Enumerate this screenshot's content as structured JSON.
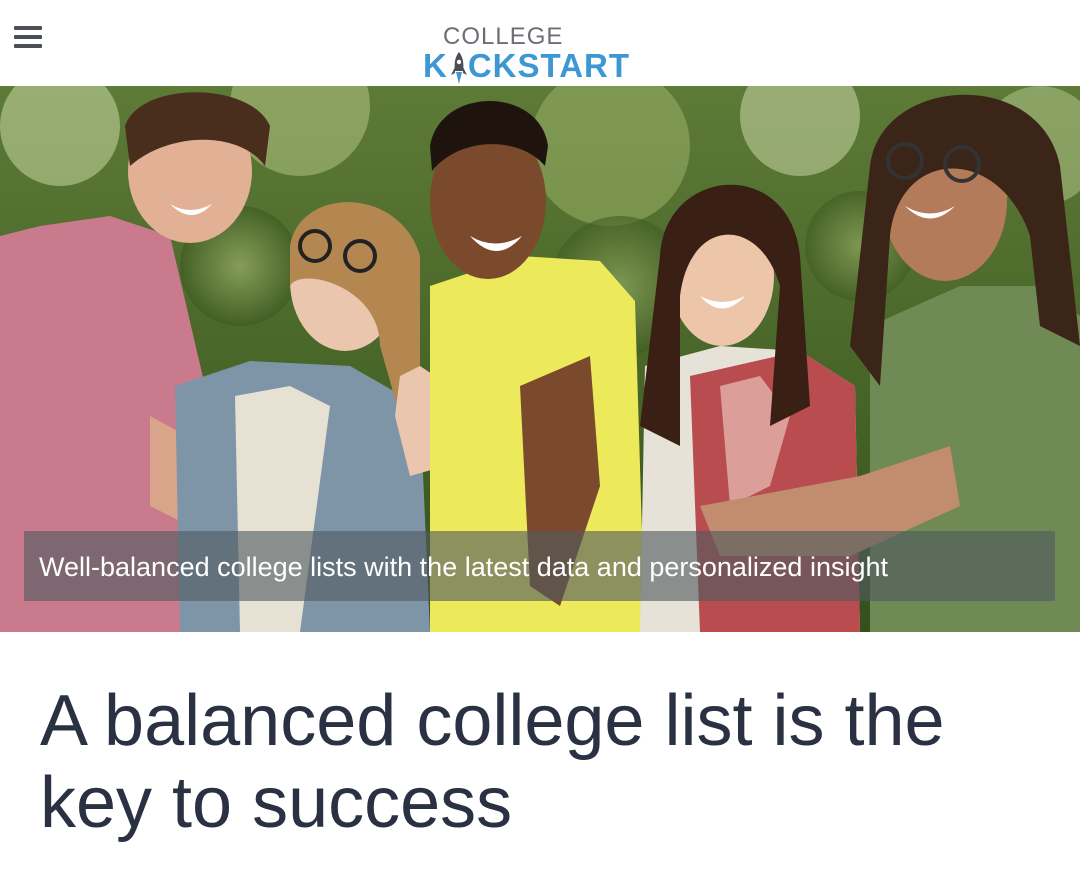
{
  "header": {
    "menu_icon": "hamburger-menu-icon",
    "logo": {
      "line1": "COLLEGE",
      "line2_part1": "K",
      "line2_part2": "CKSTART",
      "rocket_icon": "rocket-icon"
    }
  },
  "hero": {
    "image_alt": "photo of five smiling students giving thumbs up",
    "caption": "Well-balanced college lists with the latest data and personalized insight"
  },
  "main": {
    "headline": "A balanced college list is the key to success"
  },
  "colors": {
    "brand_blue": "#3d97d3",
    "logo_gray": "#6b6f75",
    "headline": "#2a3142",
    "caption_overlay": "rgba(80,90,95,0.62)"
  }
}
